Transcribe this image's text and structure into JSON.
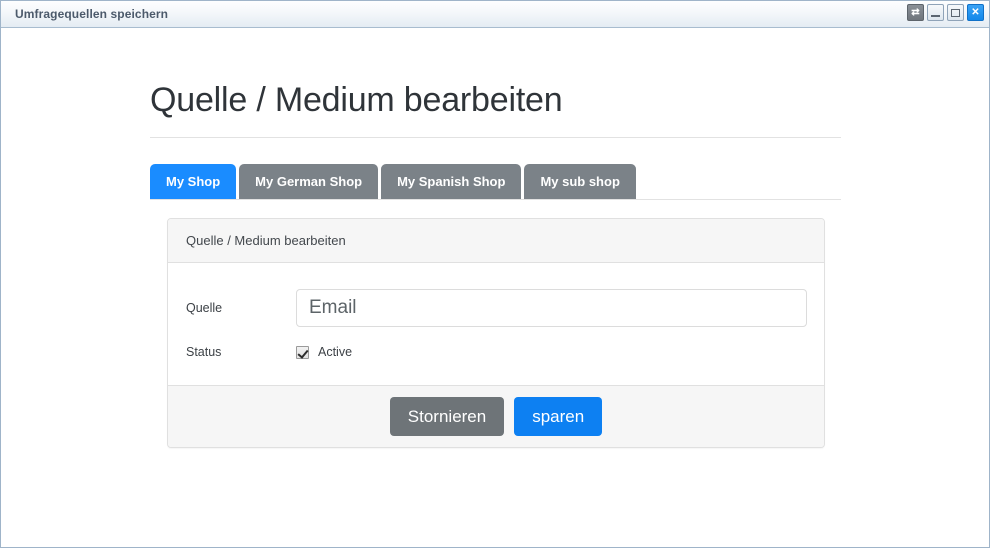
{
  "window": {
    "title": "Umfragequellen speichern",
    "controls": [
      {
        "name": "restore-icon",
        "glyph": "⇄"
      },
      {
        "name": "minimize-icon",
        "glyph": ""
      },
      {
        "name": "maximize-icon",
        "glyph": ""
      },
      {
        "name": "close-icon",
        "glyph": "✕"
      }
    ]
  },
  "page": {
    "title": "Quelle / Medium bearbeiten"
  },
  "tabs": [
    {
      "label": "My Shop",
      "active": true
    },
    {
      "label": "My German Shop",
      "active": false
    },
    {
      "label": "My Spanish Shop",
      "active": false
    },
    {
      "label": "My sub shop",
      "active": false
    }
  ],
  "panel": {
    "header": "Quelle / Medium bearbeiten",
    "fields": {
      "source": {
        "label": "Quelle",
        "value": "Email",
        "placeholder": "Email"
      },
      "status": {
        "label": "Status",
        "checkbox_label": "Active",
        "checked": true
      }
    },
    "footer": {
      "cancel_label": "Stornieren",
      "save_label": "sparen"
    }
  },
  "colors": {
    "accent_blue": "#0d80f2",
    "tab_active_blue": "#1a8cff",
    "tab_inactive_gray": "#7b8288",
    "cancel_gray": "#6e7478",
    "panel_bg": "#f6f6f6",
    "border": "#e0e0e0",
    "titlebar_border": "#a8bccf"
  }
}
